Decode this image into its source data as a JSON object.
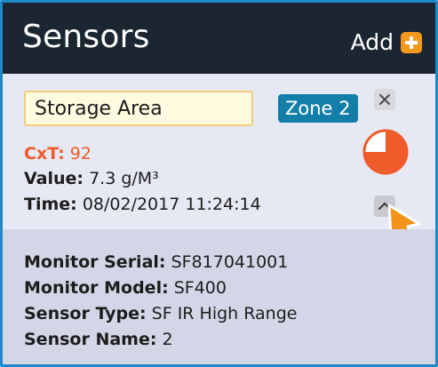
{
  "header": {
    "title": "Sensors",
    "add_label": "Add"
  },
  "sensor": {
    "name_value": "Storage Area",
    "zone": "Zone 2",
    "cxt_label": "CxT:",
    "cxt_value": "92",
    "cxt_fraction": 0.75,
    "value_label": "Value:",
    "value_value": "7.3 g/M³",
    "time_label": "Time:",
    "time_value": "08/02/2017 11:24:14"
  },
  "details": {
    "serial_label": "Monitor Serial:",
    "serial_value": "SF817041001",
    "model_label": "Monitor Model:",
    "model_value": "SF400",
    "type_label": "Sensor Type:",
    "type_value": "SF IR High Range",
    "name_label": "Sensor Name:",
    "name_value": "2"
  },
  "colors": {
    "header_bg": "#1b2631",
    "accent_orange": "#ef5b2a",
    "add_icon": "#f39a1e",
    "zone_badge": "#137fa8",
    "frame_border": "#1e88c8"
  },
  "icons": {
    "add": "plus-icon",
    "close": "close-icon",
    "status": "pie-chart-icon",
    "collapse": "chevron-up-icon",
    "pointer": "mouse-cursor-icon"
  }
}
